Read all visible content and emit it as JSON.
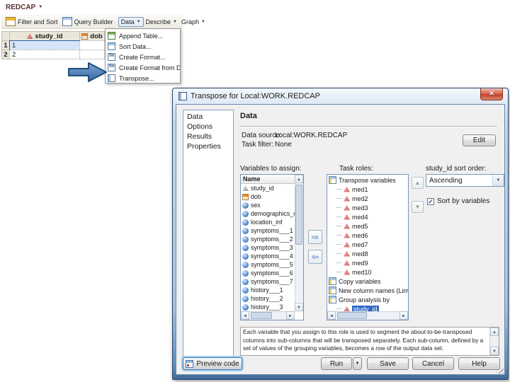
{
  "editor": {
    "tab_label": "REDCAP",
    "toolbar": {
      "filter_sort": "Filter and Sort",
      "query_builder": "Query Builder",
      "data_menu": "Data",
      "describe_menu": "Describe",
      "graph_menu": "Graph"
    },
    "grid": {
      "columns": [
        "study_id",
        "dob"
      ],
      "rows": [
        {
          "num": "1",
          "study_id": "1"
        },
        {
          "num": "2",
          "study_id": "2"
        }
      ]
    },
    "data_menu_items": [
      "Append Table...",
      "Sort Data...",
      "Create Format...",
      "Create Format from Da",
      "Transpose..."
    ]
  },
  "dialog": {
    "title": "Transpose for Local:WORK.REDCAP",
    "nav_items": [
      "Data",
      "Options",
      "Results",
      "Properties"
    ],
    "section_heading": "Data",
    "data_source_label": "Data source:",
    "data_source_value": "Local:WORK.REDCAP",
    "task_filter_label": "Task filter:",
    "task_filter_value": "None",
    "edit_button": "Edit",
    "variables_label": "Variables to assign:",
    "variables_header": "Name",
    "variables": [
      "study_id",
      "dob",
      "sex",
      "demographics_comple",
      "location_inf",
      "symptoms___1",
      "symptoms___2",
      "symptoms___3",
      "symptoms___4",
      "symptoms___5",
      "symptoms___6",
      "symptoms___7",
      "history___1",
      "history___2",
      "history___3"
    ],
    "task_roles_label": "Task roles:",
    "tree": {
      "root": "Transpose variables",
      "meds": [
        "med1",
        "med2",
        "med3",
        "med4",
        "med5",
        "med6",
        "med7",
        "med8",
        "med9",
        "med10"
      ],
      "copy_variables": "Copy variables",
      "new_column_names": "New column names (Limit...",
      "group_analysis": "Group analysis by",
      "group_value": "study_id"
    },
    "sort_order_label": "study_id sort order:",
    "sort_order_value": "Ascending",
    "sort_by_variables_label": "Sort by variables",
    "help_text": "Each variable that you assign to this role is used to segment the about-to-be-transposed columns into sub-columns that will be transposed separately. Each sub-column, defined by a set of values of the grouping variables, becomes a row of the output data set.",
    "preview_code_button": "Preview code",
    "run_button": "Run",
    "save_button": "Save",
    "cancel_button": "Cancel",
    "help_button": "Help"
  },
  "icons": {
    "caret_down": "▼",
    "up": "▲",
    "down": "▼",
    "left": "◄",
    "right": "►",
    "move_right": "⇨",
    "move_left": "⇦",
    "check": "✓",
    "close": "✕"
  },
  "colors": {
    "selection_blue": "#316ac5",
    "cell_selection_fill": "#d6e6f8",
    "annotation_arrow_blue": "#4a7ebf",
    "close_button_red": "#c23f2e",
    "window_frame_blue": "#5d8cba"
  }
}
